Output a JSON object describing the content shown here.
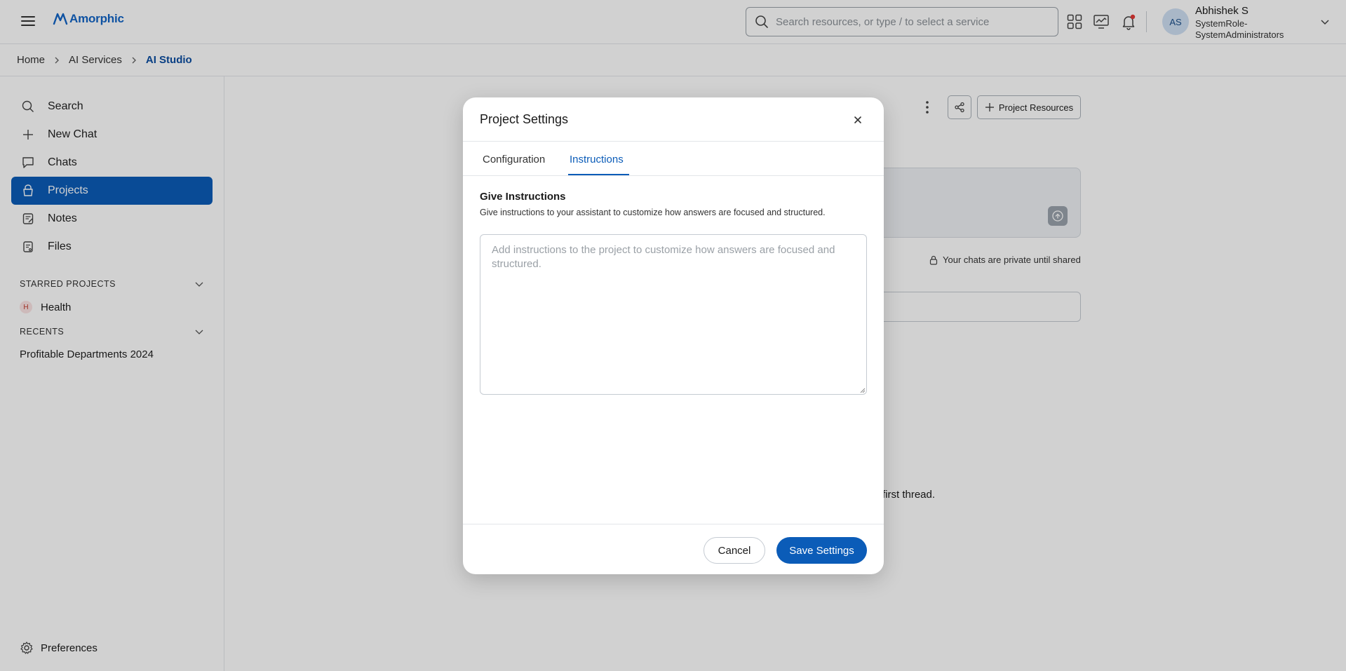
{
  "app": {
    "brand": "Amorphic",
    "brand_color": "#1264c6",
    "accent_color": "#0b5cb8"
  },
  "header": {
    "search_placeholder": "Search resources, or type / to select a service",
    "icons": [
      "search-icon",
      "apps-grid-icon",
      "monitor-chart-icon",
      "notification-bell-icon"
    ],
    "user": {
      "initials": "AS",
      "name": "Abhishek S",
      "role": "SystemRole-SystemAdministrators"
    }
  },
  "breadcrumb": [
    "Home",
    "AI Services",
    "AI Studio"
  ],
  "sidebar": {
    "items": [
      {
        "label": "Search",
        "icon": "search-icon"
      },
      {
        "label": "New Chat",
        "icon": "plus-icon"
      },
      {
        "label": "Chats",
        "icon": "chat-bubble-icon"
      },
      {
        "label": "Projects",
        "icon": "projects-icon",
        "active": true
      },
      {
        "label": "Notes",
        "icon": "notes-icon"
      },
      {
        "label": "Files",
        "icon": "files-icon"
      }
    ],
    "starred_heading": "STARRED PROJECTS",
    "starred": [
      {
        "badge": "H",
        "label": "Health"
      }
    ],
    "recents_heading": "RECENTS",
    "recents": [
      "Profitable Departments 2024"
    ],
    "preferences_label": "Preferences"
  },
  "main_background": {
    "project_resources_label": "Project Resources",
    "private_note": "Your chats are private until shared",
    "thread_text_fragment": "first thread."
  },
  "modal": {
    "title": "Project Settings",
    "tabs": [
      {
        "label": "Configuration",
        "active": false
      },
      {
        "label": "Instructions",
        "active": true
      }
    ],
    "instructions_heading": "Give Instructions",
    "instructions_description": "Give instructions to your assistant to customize how answers are focused and structured.",
    "instructions_placeholder": "Add instructions to the project to customize how answers are focused and structured.",
    "instructions_value": "",
    "cancel_label": "Cancel",
    "save_label": "Save Settings"
  }
}
